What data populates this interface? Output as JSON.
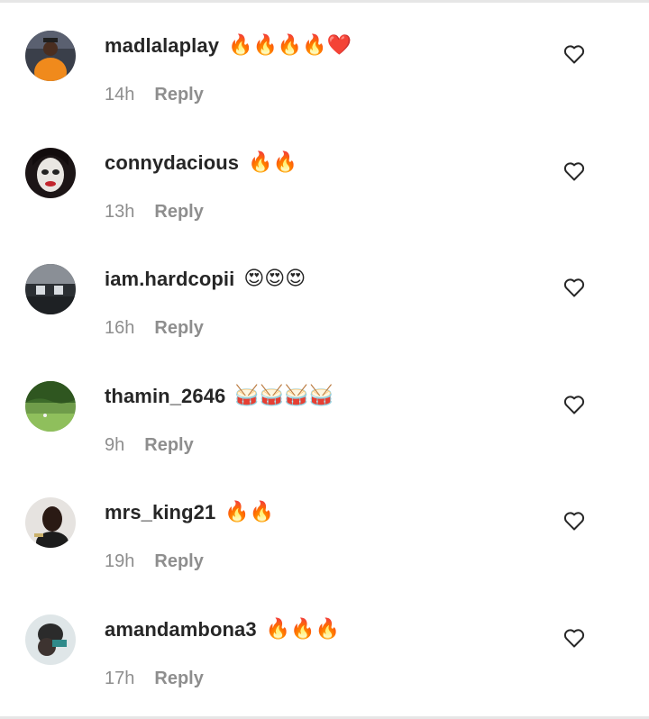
{
  "comments": [
    {
      "username": "madlalaplay",
      "text": "🔥🔥🔥🔥❤️",
      "time": "14h",
      "reply": "Reply"
    },
    {
      "username": "connydacious",
      "text": "🔥🔥",
      "time": "13h",
      "reply": "Reply"
    },
    {
      "username": "iam.hardcopii",
      "text": "😍😍😍",
      "time": "16h",
      "reply": "Reply"
    },
    {
      "username": "thamin_2646",
      "text": "🥁🥁🥁🥁",
      "time": "9h",
      "reply": "Reply"
    },
    {
      "username": "mrs_king21",
      "text": "🔥🔥",
      "time": "19h",
      "reply": "Reply"
    },
    {
      "username": "amandambona3",
      "text": "🔥🔥🔥",
      "time": "17h",
      "reply": "Reply"
    }
  ],
  "icons": {
    "like": "heart-outline-icon"
  },
  "colors": {
    "primary_text": "#262626",
    "secondary_text": "#8e8e8e",
    "divider": "#e6e6e6"
  }
}
